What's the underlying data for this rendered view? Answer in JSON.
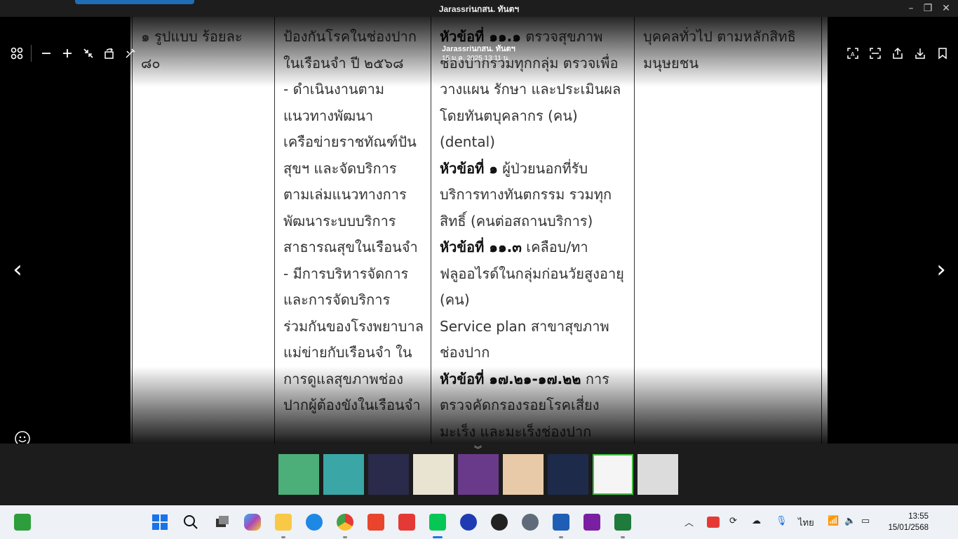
{
  "window": {
    "title": "Jarassriนกสน. ทันตฯ",
    "accent_color": "#1f6fb6"
  },
  "toolbar": {
    "left_icons": [
      "grid-icon",
      "zoom-out-icon",
      "zoom-in-icon",
      "shrink-icon",
      "rotate-icon",
      "pen-icon"
    ],
    "right_icons": [
      "text-detect-icon",
      "scan-icon",
      "share-icon",
      "download-icon",
      "bookmark-icon"
    ]
  },
  "overlay": {
    "sender": "Jarassriนกสน. ทันตฯ",
    "date": "15 ม.ค. 2025 13:11 น."
  },
  "document": {
    "col1": [
      "๑ รูปแบบ ร้อยละ",
      "๘๐"
    ],
    "col2": [
      "ป้องกันโรคในช่องปาก",
      "ในเรือนจำ ปี ๒๕๖๘",
      "- ดำเนินงานตาม",
      "แนวทางพัฒนา",
      "เครือข่ายราชทัณฑ์ปัน",
      "สุขฯ และจัดบริการ",
      "ตามเล่มแนวทางการ",
      "พัฒนาระบบบริการ",
      "สาธารณสุขในเรือนจำ",
      "- มีการบริหารจัดการ",
      "และการจัดบริการ",
      "ร่วมกันของโรงพยาบาล",
      "แม่ข่ายกับเรือนจำ ใน",
      "การดูแลสุขภาพช่อง",
      "ปากผู้ต้องขังในเรือนจำ"
    ],
    "col3_line1_bold": "หัวข้อที่ ๑๑.๑",
    "col3_line1_rest": " ตรวจสุขภาพ",
    "col3_a": [
      "ช่องปากรวมทุกกลุ่ม ตรวจเพื่อ",
      "วางแผน รักษา และประเมินผล",
      "โดยทันตบุคลากร (คน)",
      "(dental)"
    ],
    "col3_h2_bold": "หัวข้อที่ ๑",
    "col3_h2_rest": " ผู้ป่วยนอกที่รับ",
    "col3_b": [
      "บริการทางทันตกรรม รวมทุก",
      "สิทธิ์ (คนต่อสถานบริการ)"
    ],
    "col3_h3_bold": "หัวข้อที่ ๑๑.๓",
    "col3_h3_rest": " เคลือบ/ทา",
    "col3_c": [
      "ฟลูออไรด์ในกลุ่มก่อนวัยสูงอายุ",
      "(คน)",
      "Service plan สาขาสุขภาพ",
      "ช่องปาก"
    ],
    "col3_h4_bold": "หัวข้อที่ ๑๗.๒๑-๑๗.๒๒",
    "col3_h4_rest": " การ",
    "col3_d": [
      "ตรวจคัดกรองรอยโรคเสี่ยง",
      "มะเร็ง และมะเร็งช่องปาก"
    ],
    "col4": [
      "บุคคลทั่วไป ตามหลักสิทธิ",
      "มนุษยชน"
    ]
  },
  "thumbnails": [
    {
      "name": "thumbnail-1",
      "bg": "#4caf7a"
    },
    {
      "name": "thumbnail-2",
      "bg": "#3aa6a6"
    },
    {
      "name": "thumbnail-3",
      "bg": "#2a2a4a"
    },
    {
      "name": "thumbnail-4",
      "bg": "#e9e3d2"
    },
    {
      "name": "thumbnail-5",
      "bg": "#6a3a8a"
    },
    {
      "name": "thumbnail-6",
      "bg": "#e8c9a8"
    },
    {
      "name": "thumbnail-7",
      "bg": "#1e2a4a"
    },
    {
      "name": "thumbnail-8",
      "bg": "#f5f5f5",
      "active": true
    },
    {
      "name": "thumbnail-9",
      "bg": "#dcdcdc"
    }
  ],
  "taskbar": {
    "lang": "ไทย",
    "time": "13:55",
    "date": "15/01/2568"
  }
}
